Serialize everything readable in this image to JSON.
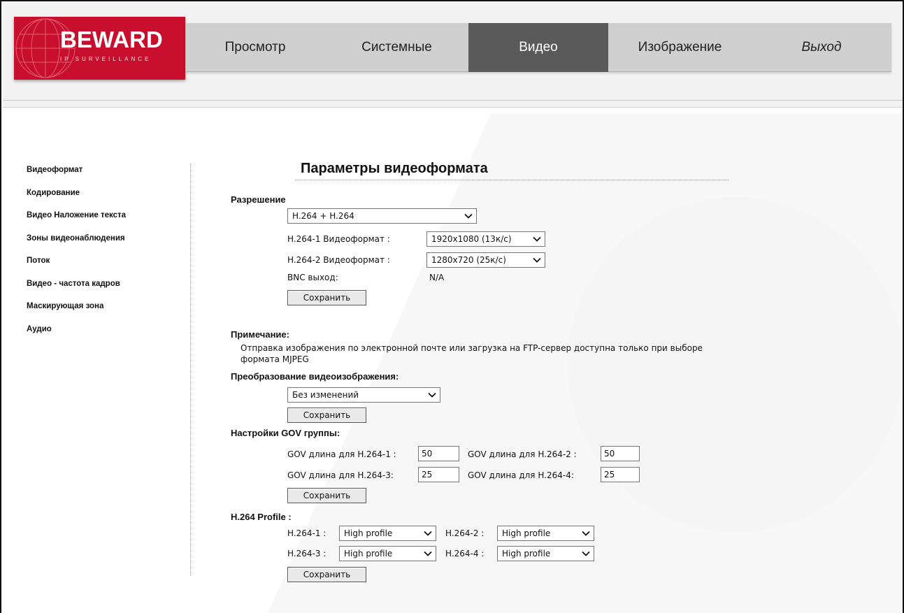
{
  "brand": {
    "name": "BEWARD",
    "tagline": "IP SURVEILLANCE",
    "color": "#c8102e"
  },
  "nav": {
    "items": [
      {
        "label": "Просмотр",
        "active": false
      },
      {
        "label": "Системные",
        "active": false
      },
      {
        "label": "Видео",
        "active": true
      },
      {
        "label": "Изображение",
        "active": false
      },
      {
        "label": "Выход",
        "active": false
      }
    ]
  },
  "sidebar": {
    "items": [
      {
        "label": "Видеоформат"
      },
      {
        "label": "Кодирование"
      },
      {
        "label": "Видео Наложение текста"
      },
      {
        "label": "Зоны видеонаблюдения"
      },
      {
        "label": "Поток"
      },
      {
        "label": "Видео - частота кадров"
      },
      {
        "label": "Маскирующая зона"
      },
      {
        "label": "Аудио"
      }
    ]
  },
  "page": {
    "title": "Параметры видеоформата"
  },
  "resolution": {
    "heading": "Разрешение",
    "mode_value": "H.264 + H.264",
    "h264_1_label": "H.264-1 Видеоформат :",
    "h264_1_value": "1920x1080 (13к/с)",
    "h264_2_label": "H.264-2 Видеоформат :",
    "h264_2_value": "1280x720 (25к/с)",
    "bnc_label": "BNC выход:",
    "bnc_value": "N/A",
    "save_label": "Сохранить"
  },
  "note": {
    "heading": "Примечание:",
    "text": "Отправка изображения по электронной почте или загрузка на FTP-сервер доступна только при выборе формата MJPEG"
  },
  "transform": {
    "heading": "Преобразование видеоизображения:",
    "value": "Без изменений",
    "save_label": "Сохранить"
  },
  "gov": {
    "heading": "Настройки GOV группы:",
    "gov1_label": "GOV длина для H.264-1 :",
    "gov1_value": "50",
    "gov2_label": "GOV длина для H.264-2 :",
    "gov2_value": "50",
    "gov3_label": "GOV длина для H.264-3:",
    "gov3_value": "25",
    "gov4_label": "GOV длина для H.264-4:",
    "gov4_value": "25",
    "save_label": "Сохранить"
  },
  "profile": {
    "heading": "H.264 Profile :",
    "p1_label": "H.264-1 :",
    "p1_value": "High profile",
    "p2_label": "H.264-2 :",
    "p2_value": "High profile",
    "p3_label": "H.264-3 :",
    "p3_value": "High profile",
    "p4_label": "H.264-4 :",
    "p4_value": "High profile",
    "save_label": "Сохранить"
  }
}
